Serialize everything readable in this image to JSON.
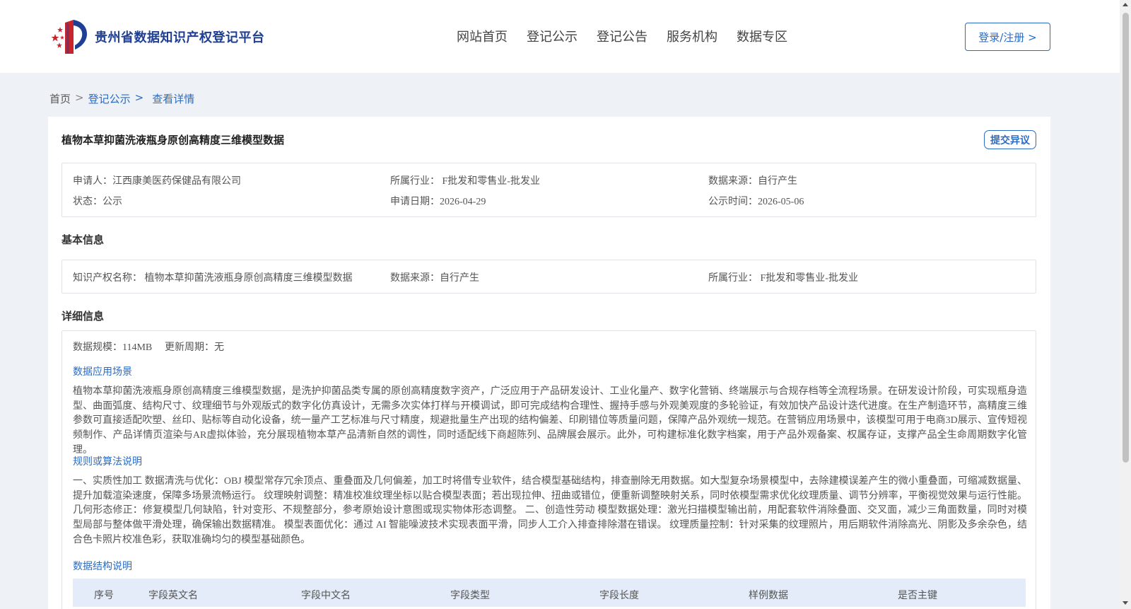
{
  "header": {
    "site_name": "贵州省数据知识产权登记平台",
    "nav": [
      "网站首页",
      "登记公示",
      "登记公告",
      "服务机构",
      "数据专区"
    ],
    "login_label": "登录/注册 >"
  },
  "breadcrumb": {
    "home": "首页",
    "sep": ">",
    "registry": "登记公示",
    "current": "查看详情"
  },
  "record": {
    "title": "植物本草抑菌洗液瓶身原创高精度三维模型数据",
    "objection_label": "提交异议",
    "summary": {
      "applicant": "申请人：江西康美医药保健品有限公司",
      "industry": "所属行业： F批发和零售业-批发业",
      "source": "数据来源：自行产生",
      "status": "状态：公示",
      "apply_date": "申请日期：2026-04-29",
      "publish_date": "公示时间：2026-05-06"
    }
  },
  "basic_info": {
    "section_title": "基本信息",
    "ip_name": "知识产权名称： 植物本草抑菌洗液瓶身原创高精度三维模型数据",
    "source": "数据来源：自行产生",
    "industry": "所属行业： F批发和零售业-批发业"
  },
  "detail_info": {
    "section_title": "详细信息",
    "scale": "数据规模：114MB",
    "update_cycle": "更新周期：无",
    "scenario_title": "数据应用场景",
    "scenario_text": "植物本草抑菌洗液瓶身原创高精度三维模型数据，是洗护抑菌品类专属的原创高精度数字资产，广泛应用于产品研发设计、工业化量产、数字化营销、终端展示与合规存档等全流程场景。在研发设计阶段，可实现瓶身造型、曲面弧度、结构尺寸、纹理细节与外观版式的数字化仿真设计，无需多次实体打样与开模调试，即可完成结构合理性、握持手感与外观美观度的多轮验证，有效加快产品设计迭代进度。在生产制造环节，高精度三维参数可直接适配吹塑、丝印、贴标等自动化设备，统一量产工艺标准与尺寸精度，规避批量生产出现的结构偏差、印刷错位等质量问题，保障产品外观统一规范。在营销应用场景中，该模型可用于电商3D展示、宣传短视频制作、产品详情页渲染与AR虚拟体验，充分展现植物本草产品清新自然的调性，同时适配线下商超陈列、品牌展会展示。此外，可构建标准化数字档案，用于产品外观备案、权属存证，支撑产品全生命周期数字化管理。",
    "rules_title": "规则或算法说明",
    "rules_text": "一、实质性加工 数据清洗与优化：OBJ 模型常存冗余顶点、重叠面及几何偏差，加工时将借专业软件，结合模型基础结构，排查删除无用数据。如大型复杂场景模型中，去除建模误差产生的微小重叠面，可缩减数据量、提升加载渲染速度，保障多场景流畅运行。 纹理映射调整：精准校准纹理坐标以贴合模型表面；若出现拉伸、扭曲或错位，便重新调整映射关系，同时依模型需求优化纹理质量、调节分辨率，平衡视觉效果与运行性能。 几何形态修正：修复模型几何缺陷，针对变形、不规整部分，参考原始设计意图或现实物体形态调整。 二、创造性劳动 模型数据处理：激光扫描模型输出前，用配套软件消除叠面、交叉面，减少三角面数量，同时对模型局部与整体做平滑处理，确保输出数据精准。 模型表面优化：通过 AI 智能噪波技术实现表面平滑，同步人工介入排查排除潜在错误。 纹理质量控制：针对采集的纹理照片，用后期软件消除高光、阴影及多余杂色，结合色卡照片校准色彩，获取准确均匀的模型基础颜色。",
    "structure_title": "数据结构说明",
    "table_headers": [
      "序号",
      "字段英文名",
      "字段中文名",
      "字段类型",
      "字段长度",
      "样例数据",
      "是否主键"
    ]
  },
  "colors": {
    "brand": "#1e3f94",
    "accent": "#2a6cc4",
    "page_bg": "#eef1f5",
    "table_header_bg": "#e3ecf8"
  }
}
